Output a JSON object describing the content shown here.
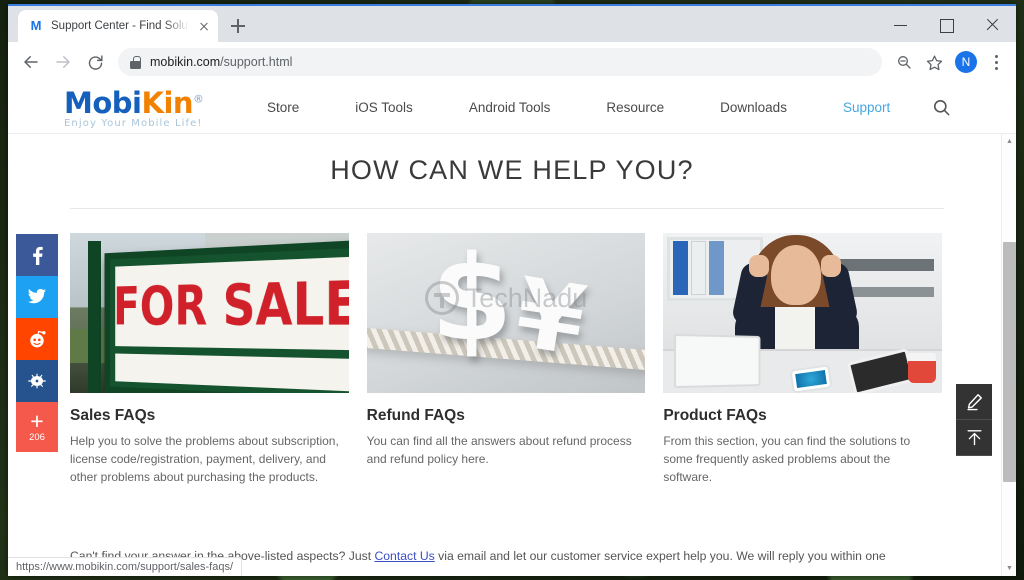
{
  "browser": {
    "tab": {
      "favicon": "m-favicon",
      "title": "Support Center - Find Solutions t"
    },
    "new_tab_label": "new-tab-icon",
    "window_controls": {
      "minimize": "minimize-icon",
      "maximize": "maximize-icon",
      "close": "close-icon"
    },
    "omnibox": {
      "domain": "mobikin.com",
      "path": "/support.html",
      "lock": "lock-icon"
    },
    "toolbar_icons": {
      "back": "back-arrow-icon",
      "forward": "forward-arrow-icon",
      "reload": "reload-icon",
      "zoom": "zoom-search-icon",
      "bookmark": "star-icon",
      "menu": "three-dot-menu-icon"
    },
    "profile_initial": "N",
    "status_url": "https://www.mobikin.com/support/sales-faqs/"
  },
  "site": {
    "logo": {
      "part1": "Mobi",
      "part2": "Kin",
      "registered": "®",
      "tagline": "Enjoy Your Mobile Life!"
    },
    "nav": [
      {
        "label": "Store",
        "active": false
      },
      {
        "label": "iOS Tools",
        "active": false
      },
      {
        "label": "Android Tools",
        "active": false
      },
      {
        "label": "Resource",
        "active": false
      },
      {
        "label": "Downloads",
        "active": false
      },
      {
        "label": "Support",
        "active": true
      }
    ],
    "search_icon": "search-icon"
  },
  "page": {
    "title": "HOW CAN WE HELP YOU?",
    "cards": [
      {
        "title": "Sales FAQs",
        "desc": "Help you to solve the problems about subscription, license code/registration, payment, delivery, and other problems about purchasing the products.",
        "image_alt": "for-sale-sign-photo",
        "sign_text": "FOR SALE"
      },
      {
        "title": "Refund FAQs",
        "desc": "You can find all the answers about refund process and refund policy here.",
        "image_alt": "currency-symbols-on-rope-photo",
        "watermark": "TechNadu",
        "dollar": "$",
        "yen": "¥"
      },
      {
        "title": "Product FAQs",
        "desc": "From this section, you can find the solutions to some frequently asked problems about the software.",
        "image_alt": "frustrated-woman-at-desk-photo"
      }
    ],
    "bottom_note": {
      "before": "Can't find your answer in the above-listed aspects? Just ",
      "link": "Contact Us",
      "after": " via email and let our customer service expert help you. We will reply you within one"
    }
  },
  "social": {
    "items": [
      {
        "name": "facebook",
        "glyph": "f",
        "color": "#3b5998"
      },
      {
        "name": "twitter",
        "glyph": "twitter-bird",
        "color": "#1da1f2"
      },
      {
        "name": "reddit",
        "glyph": "reddit-alien",
        "color": "#ff4500"
      },
      {
        "name": "mix",
        "glyph": "mix-icon",
        "color": "#26538d"
      }
    ],
    "share": {
      "plus": "+",
      "count": "206",
      "color": "#f4594c"
    }
  },
  "float_tools": [
    {
      "name": "edit-pencil",
      "icon": "pencil-icon"
    },
    {
      "name": "back-to-top",
      "icon": "up-arrow-icon"
    }
  ]
}
